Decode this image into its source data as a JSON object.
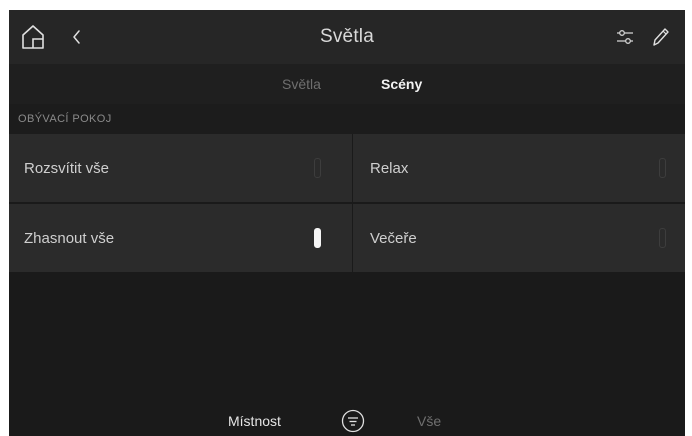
{
  "header": {
    "title": "Světla",
    "home_icon": "home-icon",
    "back_icon": "chevron-left-icon",
    "settings_icon": "sliders-icon",
    "edit_icon": "pencil-icon"
  },
  "tabs": [
    {
      "label": "Světla",
      "active": false
    },
    {
      "label": "Scény",
      "active": true
    }
  ],
  "section": {
    "title": "OBÝVACÍ POKOJ"
  },
  "scenes": [
    {
      "label": "Rozsvítit vše",
      "active": false
    },
    {
      "label": "Relax",
      "active": false
    },
    {
      "label": "Zhasnout vše",
      "active": true
    },
    {
      "label": "Večeře",
      "active": false
    }
  ],
  "bottom_nav": {
    "room_label": "Místnost",
    "filter_icon": "filter-icon",
    "all_label": "Vše"
  },
  "colors": {
    "background": "#1a1a1a",
    "bar": "#262626",
    "cell": "#2b2b2b",
    "active_text": "#f2f2f2",
    "inactive_text": "#6f6f6f"
  }
}
